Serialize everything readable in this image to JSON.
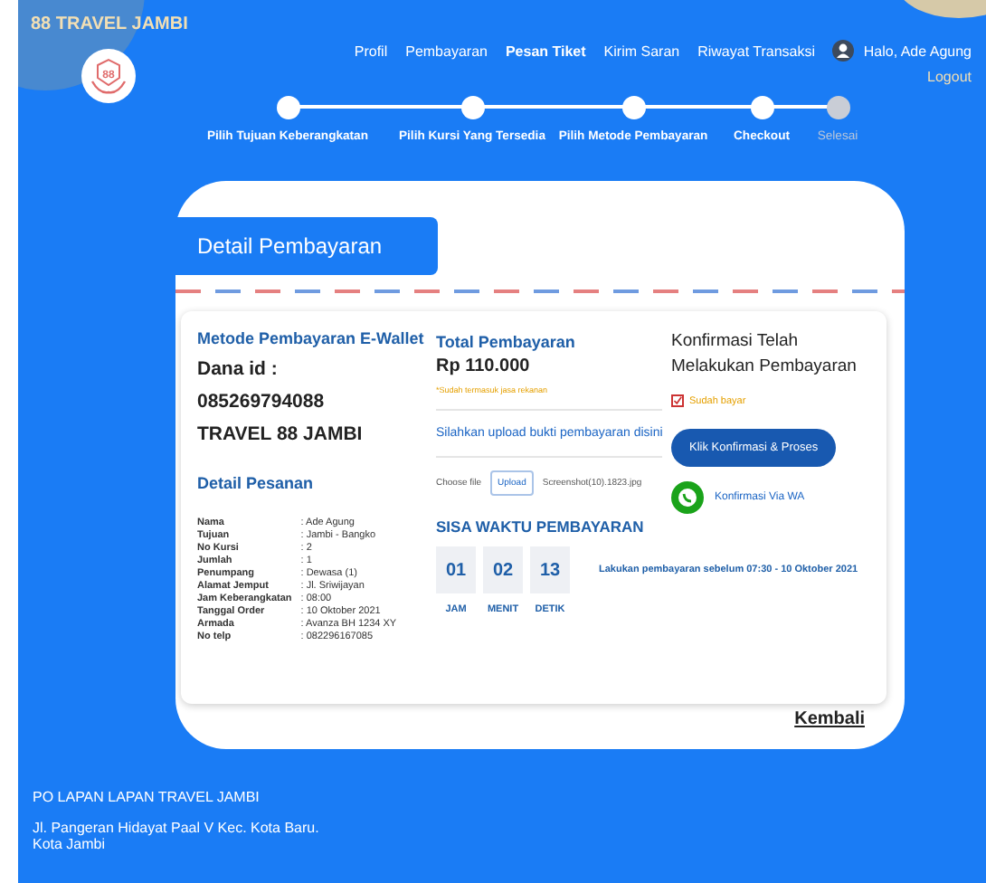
{
  "brand": {
    "name": "88 TRAVEL JAMBI",
    "logo_text": "88"
  },
  "nav": [
    {
      "label": "Profil",
      "selected": false
    },
    {
      "label": "Pembayaran",
      "selected": false
    },
    {
      "label": "Pesan Tiket",
      "selected": true
    },
    {
      "label": "Kirim Saran",
      "selected": false
    },
    {
      "label": "Riwayat Transaksi",
      "selected": false
    }
  ],
  "user": {
    "greeting": "Halo, Ade Agung",
    "logout": "Logout"
  },
  "steps": [
    {
      "label": "Pilih Tujuan Keberangkatan",
      "done": true
    },
    {
      "label": "Pilih Kursi Yang Tersedia",
      "done": true
    },
    {
      "label": "Pilih Metode Pembayaran",
      "done": true
    },
    {
      "label": "Checkout",
      "done": true
    },
    {
      "label": "Selesai",
      "done": false
    }
  ],
  "page_title": "Detail Pembayaran",
  "method": {
    "title": "Metode Pembayaran E-Wallet",
    "lines": [
      "Dana id :",
      "085269794088",
      "TRAVEL 88 JAMBI"
    ]
  },
  "order": {
    "title": "Detail Pesanan",
    "rows": [
      {
        "label": "Nama",
        "value": ": Ade Agung"
      },
      {
        "label": "Tujuan",
        "value": ": Jambi - Bangko"
      },
      {
        "label": "No Kursi",
        "value": ": 2"
      },
      {
        "label": "Jumlah",
        "value": ": 1"
      },
      {
        "label": "Penumpang",
        "value": ": Dewasa (1)"
      },
      {
        "label": "Alamat Jemput",
        "value": ": Jl. Sriwijayan"
      },
      {
        "label": "Jam Keberangkatan",
        "value": ": 08:00"
      },
      {
        "label": "Tanggal Order",
        "value": ": 10 Oktober 2021"
      },
      {
        "label": "Armada",
        "value": ": Avanza BH 1234 XY"
      },
      {
        "label": "No telp",
        "value": ": 082296167085"
      }
    ]
  },
  "total": {
    "title": "Total Pembayaran",
    "amount": "Rp 110.000",
    "note": "*Sudah termasuk jasa rekanan"
  },
  "upload": {
    "prompt": "Silahkan upload bukti pembayaran disini",
    "choose_label": "Choose file",
    "button": "Upload",
    "file_name": "Screenshot(10).1823.jpg"
  },
  "confirm": {
    "title": "Konfirmasi Telah Melakukan Pembayaran",
    "checkbox": {
      "label": "Sudah bayar",
      "checked": true
    },
    "button": "Klik Konfirmasi & Proses",
    "wa": "Konfirmasi Via WA"
  },
  "countdown": {
    "title": "SISA WAKTU PEMBAYARAN",
    "units": [
      {
        "value": "01",
        "label": "JAM"
      },
      {
        "value": "02",
        "label": "MENIT"
      },
      {
        "value": "13",
        "label": "DETIK"
      }
    ],
    "deadline": "Lakukan pembayaran sebelum 07:30 - 10 Oktober 2021"
  },
  "back": "Kembali",
  "footer": {
    "company": "PO LAPAN LAPAN TRAVEL JAMBI",
    "address": "Jl. Pangeran Hidayat Paal V Kec. Kota Baru. Kota Jambi"
  }
}
